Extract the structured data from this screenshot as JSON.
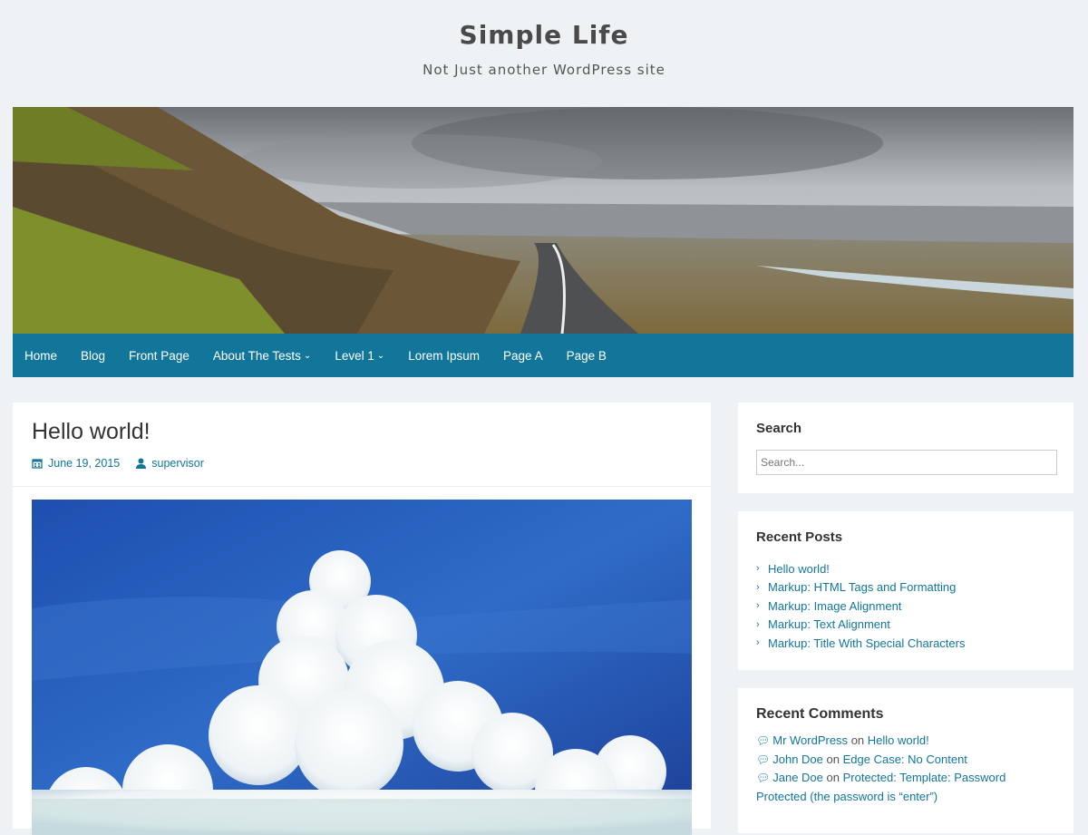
{
  "site": {
    "title": "Simple Life",
    "description": "Not Just another WordPress site"
  },
  "nav": {
    "items": [
      {
        "label": "Home"
      },
      {
        "label": "Blog"
      },
      {
        "label": "Front Page"
      },
      {
        "label": "About The Tests",
        "dropdown": true
      },
      {
        "label": "Level 1",
        "dropdown": true
      },
      {
        "label": "Lorem Ipsum"
      },
      {
        "label": "Page A"
      },
      {
        "label": "Page B"
      }
    ]
  },
  "post": {
    "title": "Hello world!",
    "date": "June 19, 2015",
    "author": "supervisor"
  },
  "sidebar": {
    "search": {
      "title": "Search",
      "placeholder": "Search..."
    },
    "recent_posts": {
      "title": "Recent Posts",
      "items": [
        "Hello world!",
        "Markup: HTML Tags and Formatting",
        "Markup: Image Alignment",
        "Markup: Text Alignment",
        "Markup: Title With Special Characters"
      ]
    },
    "recent_comments": {
      "title": "Recent Comments",
      "items": [
        {
          "author": "Mr WordPress",
          "on": "on",
          "post": "Hello world!"
        },
        {
          "author": "John Doe",
          "on": "on",
          "post": "Edge Case: No Content"
        },
        {
          "author": "Jane Doe",
          "on": "on",
          "post": "Protected: Template: Password Protected (the password is “enter”)"
        }
      ]
    }
  },
  "colors": {
    "accent": "#12769b",
    "background": "#eff2f5"
  }
}
